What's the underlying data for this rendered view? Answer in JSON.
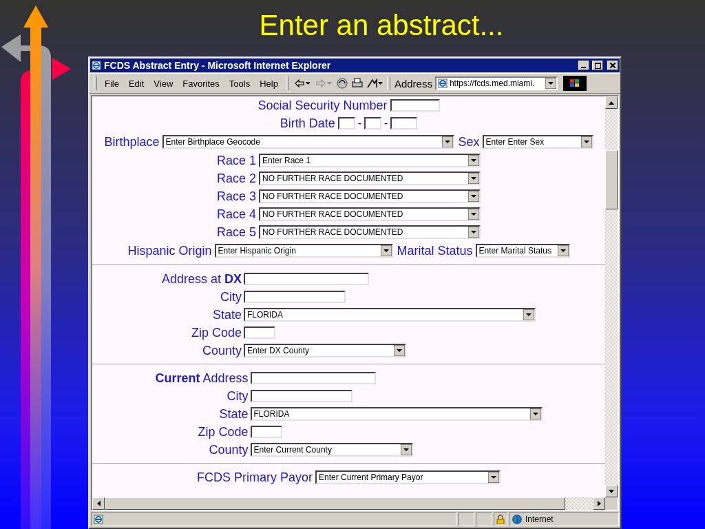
{
  "slide": {
    "title": "Enter an abstract..."
  },
  "window": {
    "title": "FCDS Abstract Entry - Microsoft Internet Explorer"
  },
  "menu": [
    "File",
    "Edit",
    "View",
    "Favorites",
    "Tools",
    "Help"
  ],
  "nav_buttons": [
    {
      "kind": "back",
      "disabled": false
    },
    {
      "kind": "forward",
      "disabled": true
    }
  ],
  "address_bar": {
    "label": "Address",
    "value": "https://fcds.med.miami."
  },
  "form": {
    "ssn": {
      "label": "Social Security Number"
    },
    "birth_date": {
      "label": "Birth Date",
      "separators": [
        "-",
        "-"
      ]
    },
    "birthplace": {
      "label": "Birthplace",
      "value": "Enter Birthplace Geocode"
    },
    "sex": {
      "label": "Sex",
      "value": "Enter Enter Sex"
    },
    "races": [
      {
        "label": "Race 1",
        "value": "Enter Race 1"
      },
      {
        "label": "Race 2",
        "value": "NO FURTHER RACE DOCUMENTED"
      },
      {
        "label": "Race 3",
        "value": "NO FURTHER RACE DOCUMENTED"
      },
      {
        "label": "Race 4",
        "value": "NO FURTHER RACE DOCUMENTED"
      },
      {
        "label": "Race 5",
        "value": "NO FURTHER RACE DOCUMENTED"
      }
    ],
    "hispanic_origin": {
      "label": "Hispanic Origin",
      "value": "Enter Hispanic Origin"
    },
    "marital_status": {
      "label": "Marital Status",
      "value": "Enter Marital Status"
    },
    "address_sections": [
      {
        "rows": [
          {
            "kind": "address",
            "label": "Address at **DX**"
          },
          {
            "kind": "city",
            "label": "City"
          },
          {
            "kind": "state",
            "label": "State",
            "value": "FLORIDA"
          },
          {
            "kind": "zip",
            "label": "Zip Code"
          },
          {
            "kind": "county",
            "label": "County",
            "value": "Enter DX County"
          }
        ]
      },
      {
        "rows": [
          {
            "kind": "address",
            "label": "**Current** Address"
          },
          {
            "kind": "city",
            "label": "City"
          },
          {
            "kind": "state",
            "label": "State",
            "value": "FLORIDA"
          },
          {
            "kind": "zip",
            "label": "Zip Code"
          },
          {
            "kind": "county",
            "label": "County",
            "value": "Enter Current County"
          }
        ]
      }
    ],
    "primary_payor": {
      "label": "FCDS Primary Payor",
      "value": "Enter Current Primary Payor"
    }
  },
  "status_bar": {
    "zone": "Internet"
  }
}
